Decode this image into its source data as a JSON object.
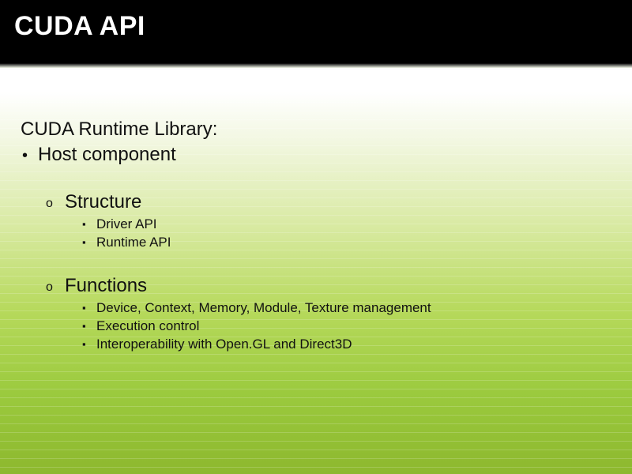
{
  "slide": {
    "title": "CUDA API",
    "heading": "CUDA Runtime Library:",
    "heading_bullets": [
      "Host component"
    ],
    "sections": [
      {
        "title": "Structure",
        "items": [
          "Driver API",
          "Runtime API"
        ]
      },
      {
        "title": "Functions",
        "items": [
          "Device, Context, Memory, Module, Texture management",
          "Execution control",
          "Interoperability with Open.GL and Direct3D"
        ]
      }
    ]
  }
}
